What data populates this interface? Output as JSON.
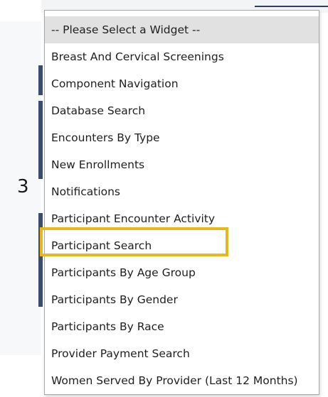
{
  "step": {
    "number": "3"
  },
  "widget_select": {
    "options": [
      {
        "label": "-- Please Select a Widget --",
        "selected": true,
        "highlighted": false
      },
      {
        "label": "Breast And Cervical Screenings",
        "selected": false,
        "highlighted": false
      },
      {
        "label": "Component Navigation",
        "selected": false,
        "highlighted": false
      },
      {
        "label": "Database Search",
        "selected": false,
        "highlighted": false
      },
      {
        "label": "Encounters By Type",
        "selected": false,
        "highlighted": false
      },
      {
        "label": "New Enrollments",
        "selected": false,
        "highlighted": false
      },
      {
        "label": "Notifications",
        "selected": false,
        "highlighted": false
      },
      {
        "label": "Participant Encounter Activity",
        "selected": false,
        "highlighted": false
      },
      {
        "label": "Participant Search",
        "selected": false,
        "highlighted": true
      },
      {
        "label": "Participants By Age Group",
        "selected": false,
        "highlighted": false
      },
      {
        "label": "Participants By Gender",
        "selected": false,
        "highlighted": false
      },
      {
        "label": "Participants By Race",
        "selected": false,
        "highlighted": false
      },
      {
        "label": "Provider Payment Search",
        "selected": false,
        "highlighted": false
      },
      {
        "label": "Women Served By Provider (Last 12 Months)",
        "selected": false,
        "highlighted": false
      }
    ]
  },
  "colors": {
    "highlight_outline": "#e8b818",
    "selected_option_bg": "#e1e1e1",
    "background_accent": "#3c4d6b"
  }
}
